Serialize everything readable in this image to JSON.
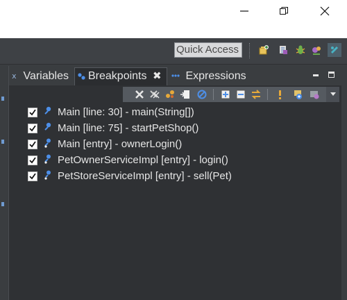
{
  "window": {
    "controls": [
      {
        "name": "minimize",
        "icon": "minimize-icon"
      },
      {
        "name": "maximize",
        "icon": "maximize-icon"
      },
      {
        "name": "close",
        "icon": "close-icon"
      }
    ]
  },
  "toolbar": {
    "quick_access_label": "Quick Access",
    "perspective_icons": [
      "open-perspective-icon",
      "java-perspective-icon",
      "debug-perspective-icon",
      "team-sync-icon",
      "git-perspective-icon"
    ]
  },
  "panel": {
    "tabs": [
      {
        "label": "Variables",
        "icon": "variables-icon",
        "active": false
      },
      {
        "label": "Breakpoints",
        "icon": "breakpoints-icon",
        "active": true,
        "close_label": "✖"
      },
      {
        "label": "Expressions",
        "icon": "expressions-icon",
        "active": false
      }
    ],
    "view_toolbar_icons": [
      "remove-selected-icon",
      "remove-all-icon",
      "show-supported-icon",
      "go-to-file-icon",
      "skip-all-icon",
      "expand-all-icon",
      "collapse-all-icon",
      "link-with-debug-icon",
      "add-exception-icon",
      "add-java-breakpoint-icon",
      "import-breakpoints-icon"
    ],
    "breakpoints": [
      {
        "label": "Main [line: 30] - main(String[])",
        "checked": true,
        "kind": "line"
      },
      {
        "label": "Main [line: 75] - startPetShop()",
        "checked": true,
        "kind": "line"
      },
      {
        "label": "Main [entry] - ownerLogin()",
        "checked": true,
        "kind": "method-entry"
      },
      {
        "label": "PetOwnerServiceImpl [entry] - login()",
        "checked": true,
        "kind": "method-entry"
      },
      {
        "label": "PetStoreServiceImpl [entry] - sell(Pet)",
        "checked": true,
        "kind": "method-entry"
      }
    ]
  },
  "colors": {
    "background": "#2f3134",
    "text": "#e6e6e6",
    "breakpoint_blue": "#4d8fe8"
  }
}
